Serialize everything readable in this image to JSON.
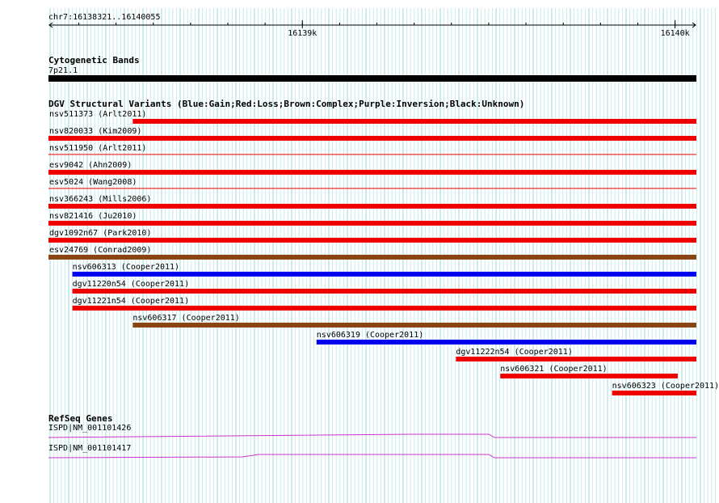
{
  "region": {
    "label": "chr7:16138321..16140055",
    "start": 16138321,
    "end": 16140055,
    "ticks": [
      {
        "pos": 16139000,
        "label": "16139k"
      },
      {
        "pos": 16140000,
        "label": "16140k"
      }
    ]
  },
  "tracks": {
    "cytoband": {
      "title": "Cytogenetic Bands",
      "band_label": "7p21.1",
      "color": "#000000"
    },
    "dgv": {
      "title": "DGV Structural Variants (Blue:Gain;Red:Loss;Brown:Complex;Purple:Inversion;Black:Unknown)",
      "colors": {
        "gain": "#0000ee",
        "loss": "#ee0000",
        "complex": "#8b4513",
        "inversion": "#800080",
        "unknown": "#000000"
      },
      "features": [
        {
          "name": "nsv511373 (Arlt2011)",
          "start": 16138321,
          "end": 16140055,
          "type": "loss",
          "style": "bar",
          "label_start": 16138321
        },
        {
          "name": "nsv820033 (Kim2009)",
          "start": 16138321,
          "end": 16140055,
          "type": "loss",
          "style": "bar",
          "label_start": 16138321
        },
        {
          "name": "nsv511950 (Arlt2011)",
          "start": 16138321,
          "end": 16140055,
          "type": "loss",
          "style": "line",
          "label_start": 16138321
        },
        {
          "name": "esv9042 (Ahn2009)",
          "start": 16138321,
          "end": 16140055,
          "type": "loss",
          "style": "bar",
          "label_start": 16138321
        },
        {
          "name": "esv5024 (Wang2008)",
          "start": 16138321,
          "end": 16140055,
          "type": "loss",
          "style": "line",
          "label_start": 16138321
        },
        {
          "name": "nsv366243 (Mills2006)",
          "start": 16138321,
          "end": 16140055,
          "type": "loss",
          "style": "bar",
          "label_start": 16138321
        },
        {
          "name": "nsv821416 (Ju2010)",
          "start": 16138321,
          "end": 16140055,
          "type": "loss",
          "style": "bar",
          "label_start": 16138321
        },
        {
          "name": "dgv1092n67 (Park2010)",
          "start": 16138321,
          "end": 16140055,
          "type": "loss",
          "style": "bar",
          "label_start": 16138321
        },
        {
          "name": "esv24769 (Conrad2009)",
          "start": 16138321,
          "end": 16140055,
          "type": "complex",
          "style": "bar",
          "label_start": 16138321
        },
        {
          "name": "nsv606313 (Cooper2011)",
          "start": 16138383,
          "end": 16140055,
          "type": "gain",
          "style": "bar",
          "label_start": 16138383
        },
        {
          "name": "dgv11220n54 (Cooper2011)",
          "start": 16138383,
          "end": 16140055,
          "type": "loss",
          "style": "bar",
          "label_start": 16138383
        },
        {
          "name": "dgv11221n54 (Cooper2011)",
          "start": 16138383,
          "end": 16140055,
          "type": "loss",
          "style": "bar",
          "label_start": 16138383
        },
        {
          "name": "nsv606317 (Cooper2011)",
          "start": 16138545,
          "end": 16140055,
          "type": "complex",
          "style": "bar",
          "label_start": 16138545
        },
        {
          "name": "nsv606319 (Cooper2011)",
          "start": 16139038,
          "end": 16140055,
          "type": "gain",
          "style": "bar",
          "label_start": 16139038
        },
        {
          "name": "dgv11222n54 (Cooper2011)",
          "start": 16139412,
          "end": 16140055,
          "type": "loss",
          "style": "bar",
          "label_start": 16139412
        },
        {
          "name": "nsv606321 (Cooper2011)",
          "start": 16139531,
          "end": 16140005,
          "type": "loss",
          "style": "bar",
          "label_start": 16139531
        },
        {
          "name": "nsv606323 (Cooper2011)",
          "start": 16139831,
          "end": 16140055,
          "type": "loss",
          "style": "bar",
          "label_start": 16139831
        }
      ]
    },
    "refseq": {
      "title": "RefSeq Genes",
      "color": "#cc33cc",
      "genes": [
        {
          "name": "ISPD|NM_001101426"
        },
        {
          "name": "ISPD|NM_001101417"
        }
      ]
    }
  }
}
